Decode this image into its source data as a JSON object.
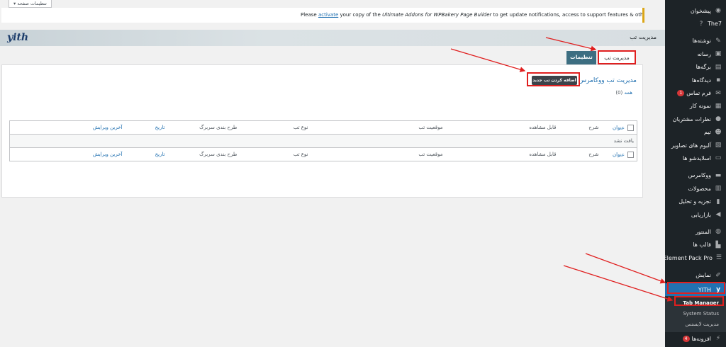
{
  "screen_options": "تنظیمات صفحه",
  "notice": {
    "before": "Please ",
    "link": "activate",
    "middle": " your copy of the ",
    "product": "Ultimate Addons for WPBakery Page Builder",
    "after": " to get update notifications, access to support features & other resources!"
  },
  "header": {
    "title": "مدیریت تب",
    "logo": "yith"
  },
  "tabs": [
    {
      "label": "مدیریت تب"
    },
    {
      "label": "تنظیمات"
    }
  ],
  "panel": {
    "title": "مدیریت تب ووکامرس",
    "add_button": "اضافه کردن تب جدید",
    "all_link": "همه",
    "all_count": "(0)"
  },
  "table": {
    "columns": [
      "عنوان",
      "شرح",
      "قابل مشاهده",
      "موقعیت تب",
      "نوع تب",
      "طرح بندی سربرگ",
      "تاریخ",
      "آخرین ویرایش"
    ],
    "empty_message": "یافت نشد"
  },
  "sidebar": {
    "items": [
      {
        "label": "پیشخوان",
        "icon": "dashboard-icon"
      },
      {
        "label": "The7",
        "icon": "help-circle-icon"
      },
      {
        "label": "نوشته‌ها",
        "icon": "pin-icon"
      },
      {
        "label": "رسانه",
        "icon": "media-icon"
      },
      {
        "label": "برگه‌ها",
        "icon": "page-icon"
      },
      {
        "label": "دیدگاه‌ها",
        "icon": "comment-icon"
      },
      {
        "label": "فرم تماس",
        "icon": "mail-icon",
        "badge": "1"
      },
      {
        "label": "نمونه کار",
        "icon": "portfolio-icon"
      },
      {
        "label": "نظرات مشتریان",
        "icon": "testimonial-icon"
      },
      {
        "label": "تیم",
        "icon": "team-icon"
      },
      {
        "label": "آلبوم های تصاویر",
        "icon": "gallery-icon"
      },
      {
        "label": "اسلایدشو ها",
        "icon": "slideshow-icon"
      },
      {
        "label": "ووکامرس",
        "icon": "woo-icon"
      },
      {
        "label": "محصولات",
        "icon": "products-icon"
      },
      {
        "label": "تجزیه و تحلیل",
        "icon": "analytics-icon"
      },
      {
        "label": "بازاریابی",
        "icon": "megaphone-icon"
      },
      {
        "label": "المنتور",
        "icon": "elementor-icon"
      },
      {
        "label": "قالب ها",
        "icon": "templates-icon"
      },
      {
        "label": "Element Pack Pro",
        "icon": "element-pack-icon"
      },
      {
        "label": "نمایش",
        "icon": "brush-icon"
      },
      {
        "label": "YITH",
        "icon": "yith-icon"
      },
      {
        "label": "افزونه‌ها",
        "icon": "plugin-icon",
        "badge": "4"
      }
    ],
    "yith_submenu": [
      "Tab Manager",
      "System Status",
      "مدیریت لایسنس"
    ]
  }
}
